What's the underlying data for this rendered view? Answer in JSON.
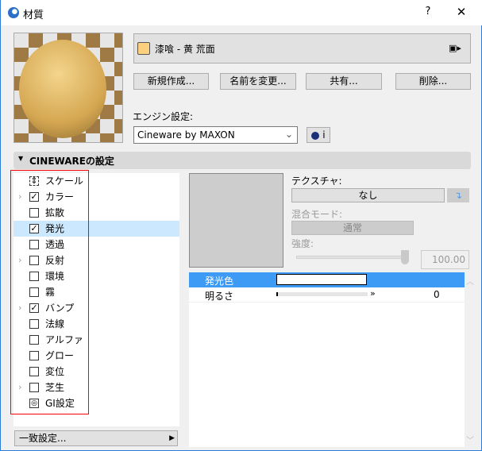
{
  "window": {
    "title": "材質",
    "help": "?",
    "close": "✕"
  },
  "material": {
    "name": "漆喰 - 黄 荒面",
    "swatch": "#fcd07e"
  },
  "buttons": {
    "new": "新規作成...",
    "rename": "名前を変更...",
    "share": "共有...",
    "delete": "削除..."
  },
  "engine": {
    "label": "エンジン設定:",
    "value": "Cineware by MAXON",
    "info": "i"
  },
  "section": {
    "title": "CINEWAREの設定"
  },
  "channels": [
    {
      "label": "スケール",
      "type": "scale",
      "expand": false
    },
    {
      "label": "カラー",
      "checked": true,
      "expand": true
    },
    {
      "label": "拡散",
      "checked": false,
      "expand": false
    },
    {
      "label": "発光",
      "checked": true,
      "expand": false,
      "selected": true
    },
    {
      "label": "透過",
      "checked": false,
      "expand": false
    },
    {
      "label": "反射",
      "checked": false,
      "expand": true
    },
    {
      "label": "環境",
      "checked": false,
      "expand": false
    },
    {
      "label": "霧",
      "checked": false,
      "expand": false
    },
    {
      "label": "バンプ",
      "checked": true,
      "expand": true
    },
    {
      "label": "法線",
      "checked": false,
      "expand": false
    },
    {
      "label": "アルファ",
      "checked": false,
      "expand": false
    },
    {
      "label": "グロー",
      "checked": false,
      "expand": false
    },
    {
      "label": "変位",
      "checked": false,
      "expand": false
    },
    {
      "label": "芝生",
      "checked": false,
      "expand": true
    },
    {
      "label": "GI設定",
      "type": "gi",
      "expand": false
    }
  ],
  "match": {
    "label": "一致設定..."
  },
  "texture": {
    "label": "テクスチャ:",
    "value": "なし"
  },
  "blend": {
    "label": "混合モード:",
    "value": "通常"
  },
  "strength": {
    "label": "強度:",
    "value": "100.00",
    "percent": 100
  },
  "props": [
    {
      "name": "発光色",
      "color": "#ffffff"
    },
    {
      "name": "明るさ",
      "value": "0"
    }
  ],
  "colors": {
    "accent": "#3d9bf5",
    "selected": "#cce8ff",
    "highlight": "#ff0000"
  }
}
